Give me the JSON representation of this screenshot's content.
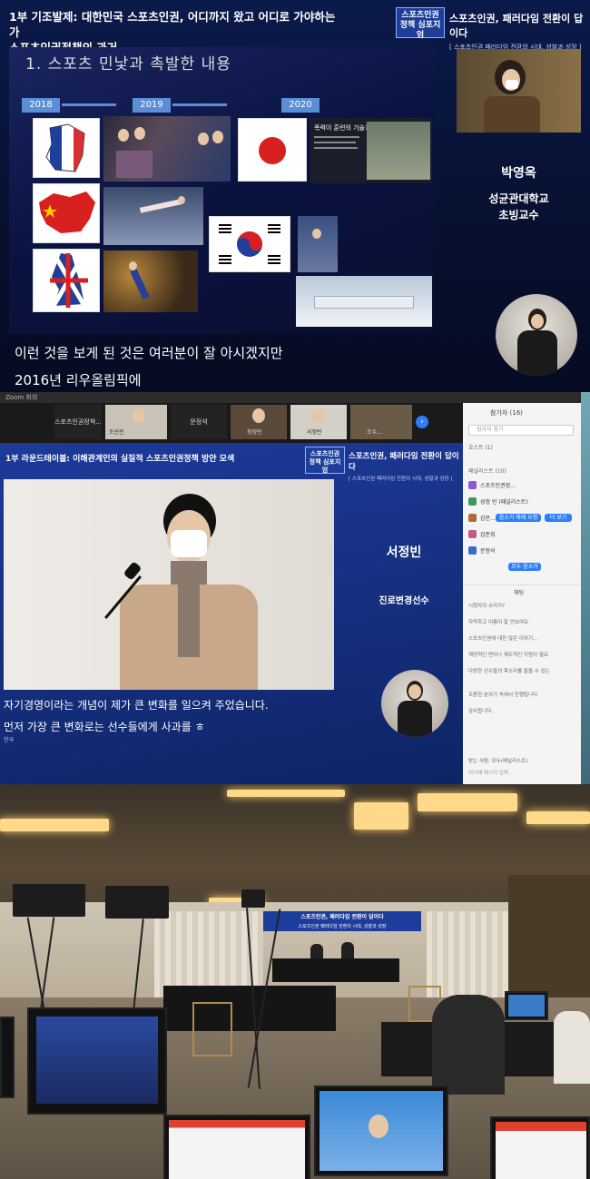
{
  "panel1": {
    "event_title_line1": "1부 기조발제: 대한민국 스포츠인권, 어디까지 왔고 어디로 가야하는가",
    "event_title_line2": "스포츠인권정책의 과거",
    "badge_text": "스포츠인권정책 심포지엄",
    "slogan": "스포츠인권, 패러다임 전환이 답이다",
    "slogan_sub": "[ 스포츠인권 패러다임 전환의 시대, 성찰과 성장 ]",
    "slide_heading": "1. 스포츠 민낯과 촉발한 내용",
    "years": [
      "2018",
      "2019",
      "2020"
    ],
    "news_headline": "폭력이 훈련의 기술?",
    "speaker_name": "박영옥",
    "speaker_affiliation": "성균관대학교",
    "speaker_title": "초빙교수",
    "caption_line1": "이런 것을 보게 된 것은 여러분이 잘 아시겠지만",
    "caption_line2": "2016년 리우올림픽에"
  },
  "panel2": {
    "zoom_label": "Zoom 회의",
    "thumbnails": [
      "스포츠인권정책...",
      "조선진",
      "문정석",
      "최정빈",
      "서정빈",
      "조수..."
    ],
    "session_title": "1부 라운드테이블: 이해관계인의 실질적 스포츠인권정책 방안 모색",
    "badge_text": "스포츠인권정책 심포지엄",
    "slogan": "스포츠인권, 패러다임 전환이 답이다",
    "slogan_sub": "[ 스포츠인권 패러다임 전환의 시대, 성찰과 성장 ]",
    "speaker_name": "서정빈",
    "speaker_role": "진로변경선수",
    "caption_line1": "자기경영이라는 개념이 제가 큰 변화를 일으켜 주었습니다.",
    "caption_line2": "먼저 가장 큰 변화로는 선수들에게 사과를 ㅎ",
    "caption_tag": "한국",
    "participants_header": "참가자 (16)",
    "search_placeholder": "참가자 찾기",
    "hosts_label": "호스트 (1)",
    "attendees_label": "패널리스트 (10)",
    "participants": [
      {
        "name": "스포츠인권정...",
        "color": "#8e5ad1"
      },
      {
        "name": "성정 빈 (패널리스트)",
        "color": "#3a9a5b"
      },
      {
        "name": "김문...",
        "color": "#b06a3a"
      },
      {
        "name": "김준희",
        "color": "#c25a8a"
      },
      {
        "name": "문정석",
        "color": "#3a6ac9"
      }
    ],
    "btn_allow": "음소거 해제 요청",
    "btn_more": "더 보기",
    "btn_invite": "모두 음소거",
    "chat_header": "채팅",
    "chat_lines": [
      "시청자의 소리가?",
      "자막하고 이름이 잘 안보여요",
      "스포츠인권에 대한 많은 이야기...",
      "재정적인 면이나 제도적인 지원이 필요",
      "다양한 선수들의 목소리를 들을 수 있는",
      "조용한 분위기 속에서 진행됩니다.",
      "감사합니다."
    ],
    "chat_input_label": "받는 사람: 모두(패널리스트)",
    "chat_input_placeholder": "여기에 메시지 입력..."
  },
  "panel3": {
    "banner_title": "스포츠인권, 패러다임 전환이 답이다",
    "banner_sub": "스포츠인권 패러다임 전환의 시대, 성찰과 성장"
  }
}
